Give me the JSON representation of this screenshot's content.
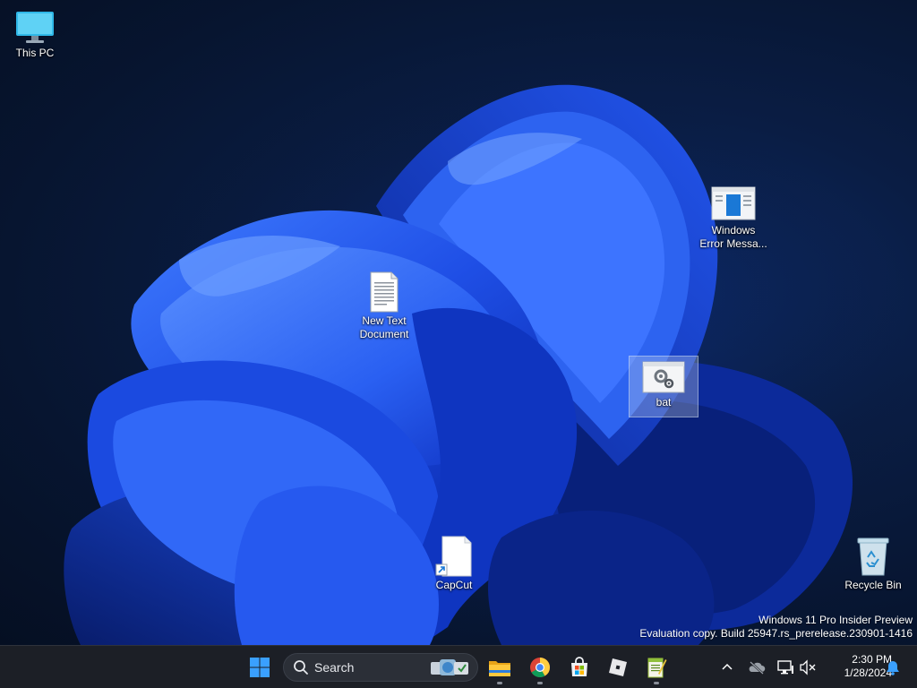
{
  "desktop": {
    "icons": {
      "this_pc": {
        "label": "This PC"
      },
      "windows_error": {
        "label_line1": "Windows",
        "label_line2": "Error Messa..."
      },
      "new_text": {
        "label_line1": "New Text",
        "label_line2": "Document"
      },
      "bat": {
        "label": "bat"
      },
      "capcut": {
        "label": "CapCut"
      },
      "recycle_bin": {
        "label": "Recycle Bin"
      }
    },
    "watermark": {
      "line1": "Windows 11 Pro Insider Preview",
      "line2": "Evaluation copy. Build 25947.rs_prerelease.230901-1416"
    }
  },
  "taskbar": {
    "search": {
      "label": "Search"
    },
    "apps": [
      {
        "name": "start",
        "icon": "windows-logo-icon"
      },
      {
        "name": "file-explorer",
        "icon": "folder-icon"
      },
      {
        "name": "chrome",
        "icon": "chrome-icon"
      },
      {
        "name": "microsoft-store",
        "icon": "store-icon"
      },
      {
        "name": "roblox",
        "icon": "roblox-icon"
      },
      {
        "name": "notepad-plus",
        "icon": "notepad-plus-icon"
      }
    ],
    "tray": {
      "icons": [
        "chevron-up-icon",
        "onedrive-offline-icon",
        "network-icon",
        "volume-muted-icon",
        "notification-bell-icon"
      ]
    },
    "clock": {
      "time": "2:30 PM",
      "date": "1/28/2024"
    }
  },
  "colors": {
    "accent": "#0a5fff",
    "taskbar_bg": "#1c1f26",
    "wallpaper_dark": "#071530"
  }
}
